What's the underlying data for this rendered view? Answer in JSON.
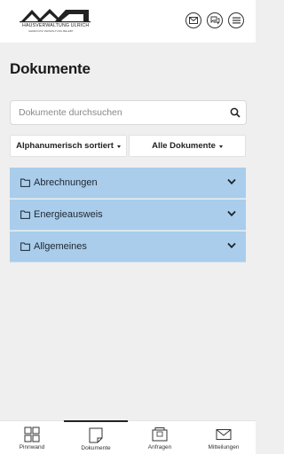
{
  "header": {
    "brand": "HAUSVERWALTUNG ULRICH",
    "tagline": "GERECHTE VERWALTUNG BELEBT",
    "icons": [
      "mail-icon",
      "chat-icon",
      "menu-icon"
    ]
  },
  "page": {
    "title": "Dokumente"
  },
  "search": {
    "placeholder": "Dokumente durchsuchen",
    "value": ""
  },
  "filters": {
    "sort_label": "Alphanumerisch sortiert",
    "type_label": "Alle Dokumente"
  },
  "folders": [
    {
      "label": "Abrechnungen"
    },
    {
      "label": "Energieausweis"
    },
    {
      "label": "Allgemeines"
    }
  ],
  "colors": {
    "folder_bg": "#a9cdeb",
    "page_bg": "#efefef",
    "text": "#222222"
  },
  "tabs": [
    {
      "label": "Pinnwand",
      "icon": "grid-icon",
      "active": false
    },
    {
      "label": "Dokumente",
      "icon": "document-icon",
      "active": true
    },
    {
      "label": "Anfragen",
      "icon": "folder-stack-icon",
      "active": false
    },
    {
      "label": "Mitteilungen",
      "icon": "envelope-icon",
      "active": false
    }
  ]
}
